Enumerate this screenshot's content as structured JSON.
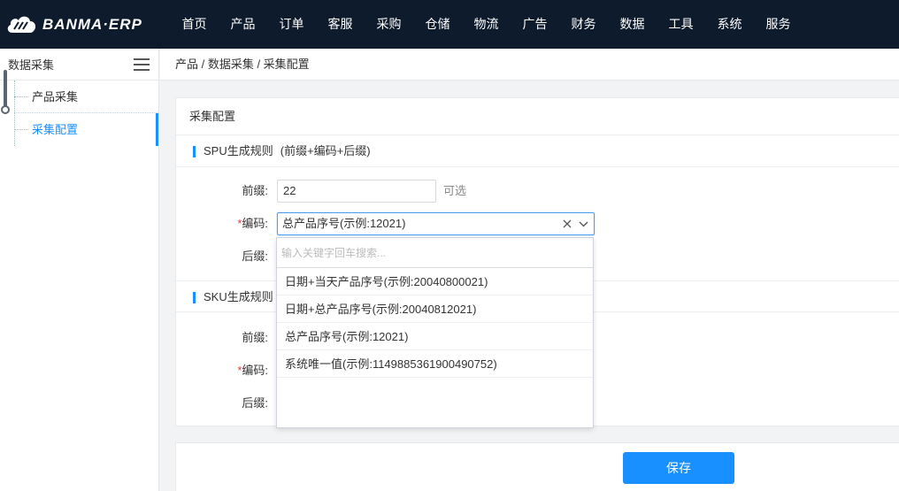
{
  "brand": {
    "logo_text": "BANMA·ERP"
  },
  "nav": [
    "首页",
    "产品",
    "订单",
    "客服",
    "采购",
    "仓储",
    "物流",
    "广告",
    "财务",
    "数据",
    "工具",
    "系统",
    "服务"
  ],
  "sidebar": {
    "title": "数据采集",
    "items": [
      {
        "label": "产品采集",
        "active": false
      },
      {
        "label": "采集配置",
        "active": true
      }
    ]
  },
  "breadcrumb": "产品 / 数据采集 / 采集配置",
  "card": {
    "title": "采集配置",
    "spu": {
      "heading": "SPU生成规则",
      "hint": "(前缀+编码+后缀)",
      "prefix_label": "前缀:",
      "prefix_value": "22",
      "optional_text": "可选",
      "code_required": "*",
      "code_label": "编码:",
      "code_value": "总产品序号(示例:12021)",
      "suffix_label": "后缀:"
    },
    "sku": {
      "heading": "SKU生成规则",
      "prefix_label": "前缀:",
      "code_required": "*",
      "code_label": "编码:",
      "suffix_label": "后缀:"
    }
  },
  "dropdown": {
    "search_placeholder": "输入关键字回车搜索...",
    "options": [
      "日期+当天产品序号(示例:20040800021)",
      "日期+总产品序号(示例:20040812021)",
      "总产品序号(示例:12021)",
      "系统唯一值(示例:1149885361900490752)"
    ]
  },
  "save_label": "保存",
  "colors": {
    "topbar": "#0e1b2d",
    "accent": "#1890ff"
  }
}
